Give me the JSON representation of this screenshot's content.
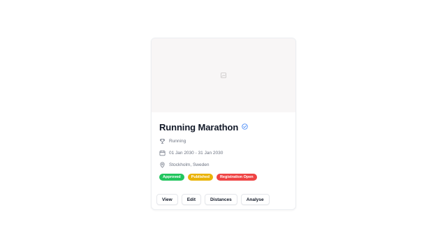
{
  "event": {
    "title": "Running Marathon",
    "sport": "Running",
    "dates": "01 Jan 2030 - 31 Jan 2030",
    "location": "Stockholm, Sweden"
  },
  "badges": [
    {
      "label": "Approved",
      "color": "#22c55e"
    },
    {
      "label": "Published",
      "color": "#eab308"
    },
    {
      "label": "Registration Open",
      "color": "#ef4444"
    }
  ],
  "actions": {
    "view_label": "View",
    "edit_label": "Edit",
    "distances_label": "Distances",
    "analyse_label": "Analyse"
  },
  "icons": {
    "banner": "image-placeholder-icon",
    "verified": "verified-check-icon",
    "sport": "trophy-icon",
    "dates": "calendar-icon",
    "location": "map-pin-icon"
  },
  "colors": {
    "banner_bg": "#f8f6f6",
    "verified_accent": "#3b82f6",
    "muted_text": "#6b7280"
  }
}
